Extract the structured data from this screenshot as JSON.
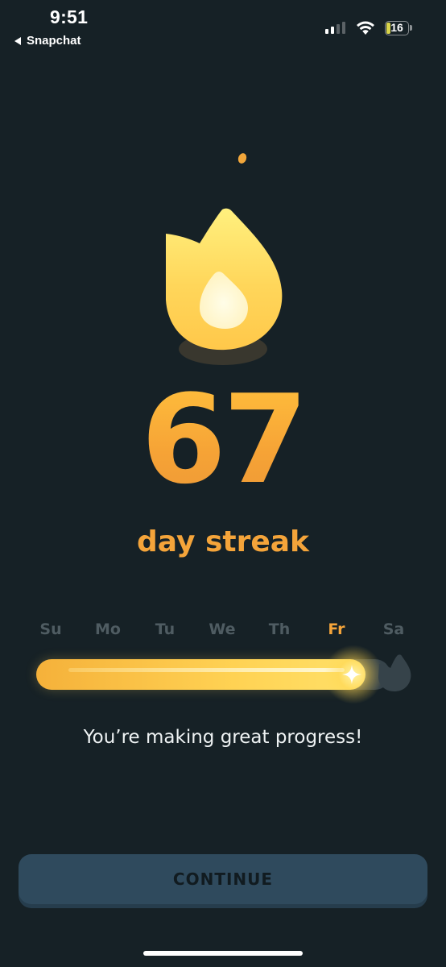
{
  "status_bar": {
    "time": "9:51",
    "back_app": "Snapchat",
    "battery_level": "16"
  },
  "streak": {
    "count": "67",
    "label": "day streak"
  },
  "week": {
    "days": [
      "Su",
      "Mo",
      "Tu",
      "We",
      "Th",
      "Fr",
      "Sa"
    ],
    "active_day_index": 5,
    "progress_fraction": 0.93
  },
  "message": "You’re making great progress!",
  "continue_label": "CONTINUE",
  "colors": {
    "background": "#162126",
    "accent": "#f4a43a",
    "flame_yellow": "#ffd65a",
    "inactive_day": "#4f5c62",
    "button": "#2f4a5d"
  },
  "icons": {
    "flame": "flame-icon",
    "goal": "goal-flame-icon",
    "sparkle": "sparkle-icon"
  }
}
